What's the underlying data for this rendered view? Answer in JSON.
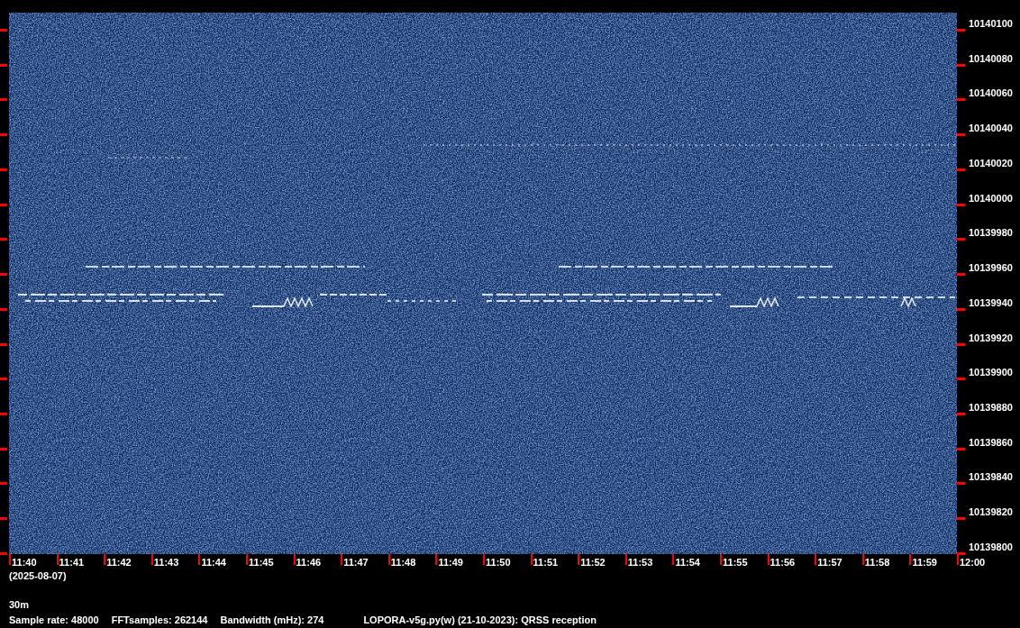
{
  "frequency_axis": {
    "ticks": [
      "10140100",
      "10140080",
      "10140060",
      "10140040",
      "10140020",
      "10140000",
      "10139980",
      "10139960",
      "10139940",
      "10139920",
      "10139900",
      "10139880",
      "10139860",
      "10139840",
      "10139820",
      "10139800"
    ]
  },
  "time_axis": {
    "ticks": [
      "11:40",
      "11:41",
      "11:42",
      "11:43",
      "11:44",
      "11:45",
      "11:46",
      "11:47",
      "11:48",
      "11:49",
      "11:50",
      "11:51",
      "11:52",
      "11:53",
      "11:54",
      "11:55",
      "11:56",
      "11:57",
      "11:58",
      "11:59",
      "12:00"
    ]
  },
  "date": "(2025-08-07)",
  "band": "30m",
  "info": [
    "Sample rate: 48000",
    "FFTsamples: 262144",
    "Bandwidth (mHz): 274",
    "LOPORA-v5g.py(w) (21-10-2023): QRSS reception"
  ]
}
